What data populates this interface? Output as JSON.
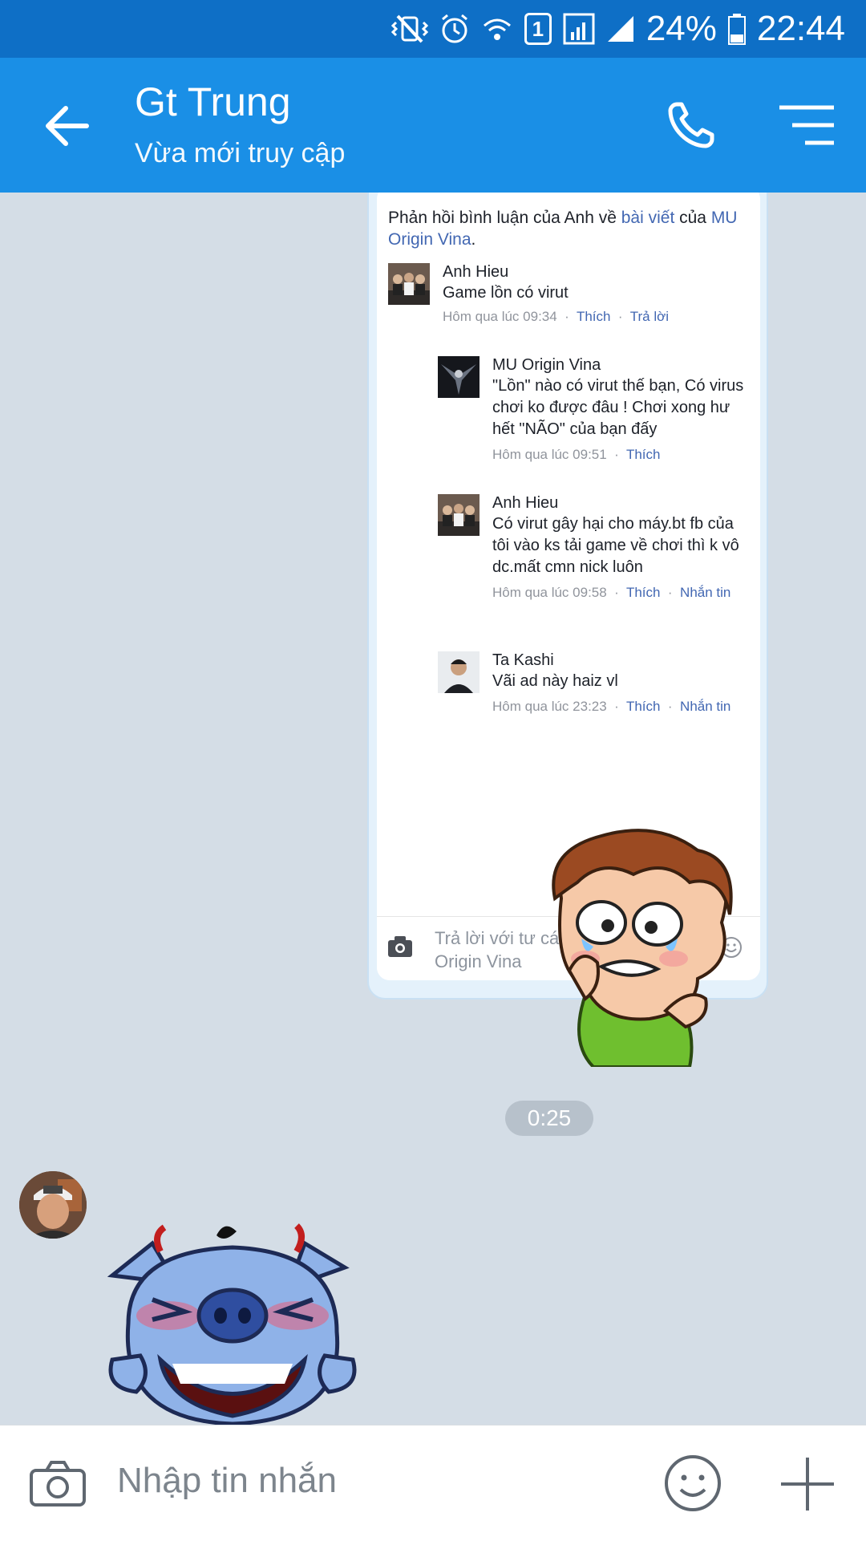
{
  "status_bar": {
    "sim_label": "1",
    "battery_percent": "24%",
    "time": "22:44"
  },
  "header": {
    "title": "Gt Trung",
    "subtitle": "Vừa mới truy cập"
  },
  "shared_screenshot": {
    "intro_prefix": "Phản hồi bình luận của Anh về ",
    "intro_link": "bài viết",
    "intro_mid": " của ",
    "intro_page": "MU Origin Vina",
    "intro_end": ".",
    "comments": [
      {
        "name": "Anh Hieu",
        "text": "Game lồn có virut",
        "time": "Hôm qua lúc 09:34",
        "actions": [
          "Thích",
          "Trả lời"
        ]
      },
      {
        "name": "MU Origin Vina",
        "text": "\"Lồn\" nào có virut thế bạn, Có virus chơi ko được đâu ! Chơi xong hư hết \"NÃO\" của bạn đấy",
        "time": "Hôm qua lúc 09:51",
        "actions": [
          "Thích"
        ]
      },
      {
        "name": "Anh Hieu",
        "text": "Có virut gây hại cho máy.bt fb của tôi vào ks tải game về chơi thì k vô dc.mất cmn nick luôn",
        "time": "Hôm qua lúc 09:58",
        "actions": [
          "Thích",
          "Nhắn tin"
        ]
      },
      {
        "name": "Ta Kashi",
        "text": "Vãi ad này haiz vl",
        "time": "Hôm qua lúc 23:23",
        "actions": [
          "Thích",
          "Nhắn tin"
        ]
      }
    ],
    "reply_placeholder": "Trả lời với tư cách là MU Origin Vina"
  },
  "messages": {
    "time_pill": "0:25"
  },
  "input": {
    "placeholder": "Nhập tin nhắn"
  },
  "colors": {
    "status_bar": "#0e6fc6",
    "header": "#1a8fe6",
    "chat_bg": "#d4dde6",
    "link": "#4267b2"
  }
}
